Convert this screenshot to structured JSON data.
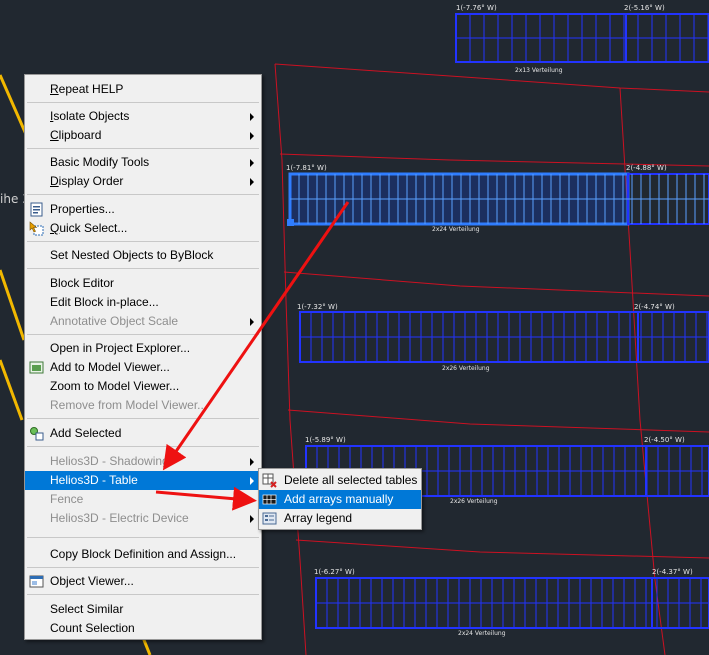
{
  "drawing": {
    "side_text": "ihe 3",
    "tables": [
      {
        "left_label": "1(-7.76° W)",
        "right_label": "2(-5.16° W)",
        "caption": "2x13 Verteilung"
      },
      {
        "left_label": "1(-7.81° W)",
        "right_label": "2(-4.88° W)",
        "caption": "2x24 Verteilung"
      },
      {
        "left_label": "1(-7.32° W)",
        "right_label": "2(-4.74° W)",
        "caption": "2x26 Verteilung"
      },
      {
        "left_label": "1(-5.89° W)",
        "right_label": "2(-4.50° W)",
        "caption": "2x26 Verteilung"
      },
      {
        "left_label": "1(-6.27° W)",
        "right_label": "2(-4.37° W)",
        "caption": "2x24 Verteilung"
      }
    ]
  },
  "context_menu": {
    "items": [
      {
        "label": "Repeat HELP",
        "ul": "R",
        "rest": "epeat HELP"
      },
      {
        "label": "Isolate Objects",
        "ul": "I",
        "rest": "solate Objects"
      },
      {
        "label": "Clipboard",
        "ul": "C",
        "rest": "lipboard"
      },
      {
        "label": "Basic Modify Tools",
        "ul": "",
        "rest": "Basic Modify Tools"
      },
      {
        "label": "Display Order",
        "ul": "D",
        "rest": "isplay Order"
      },
      {
        "label": "Properties...",
        "ul": "",
        "rest": "Properties..."
      },
      {
        "label": "Quick Select...",
        "ul": "Q",
        "rest": "uick Select..."
      },
      {
        "label": "Set Nested Objects to ByBlock"
      },
      {
        "label": "Block Editor"
      },
      {
        "label": "Edit Block in-place..."
      },
      {
        "label": "Annotative Object Scale"
      },
      {
        "label": "Open in Project Explorer..."
      },
      {
        "label": "Add to Model Viewer..."
      },
      {
        "label": "Zoom to Model Viewer..."
      },
      {
        "label": "Remove from Model Viewer..."
      },
      {
        "label": "Add Selected"
      },
      {
        "label": "Helios3D - Shadowing"
      },
      {
        "label": "Helios3D - Table"
      },
      {
        "label": "Fence"
      },
      {
        "label": "Helios3D - Electric Device"
      },
      {
        "label": "Copy Block Definition and Assign..."
      },
      {
        "label": "Object Viewer..."
      },
      {
        "label": "Select Similar"
      },
      {
        "label": "Count Selection"
      }
    ]
  },
  "submenu": {
    "items": [
      {
        "label": "Delete all selected tables"
      },
      {
        "label": "Add arrays manually"
      },
      {
        "label": "Array legend"
      }
    ]
  },
  "colors": {
    "menu_highlight": "#0078d7",
    "array_outline": "#2233ff",
    "annotation_arrow": "#ee1111",
    "boundary_line": "#cc1122",
    "guide_line": "#f2b800"
  }
}
